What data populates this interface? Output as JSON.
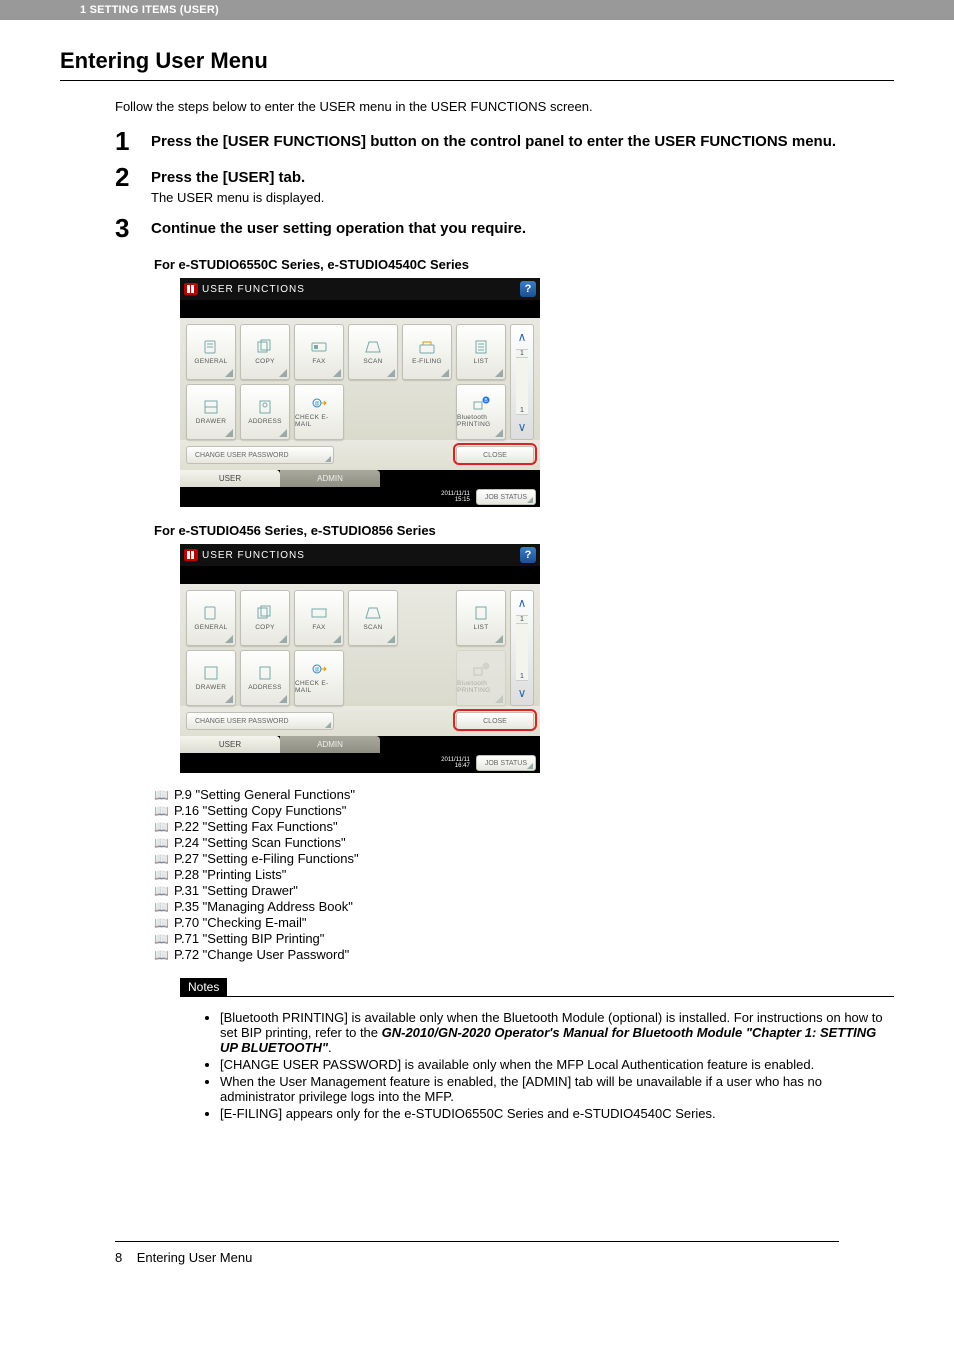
{
  "header": {
    "bar_text": "1 SETTING ITEMS (USER)"
  },
  "title": "Entering User Menu",
  "intro": "Follow the steps below to enter the USER menu in the USER FUNCTIONS screen.",
  "steps": [
    {
      "num": "1",
      "title": "Press the [USER FUNCTIONS] button on the control panel to enter the USER FUNCTIONS menu."
    },
    {
      "num": "2",
      "title": "Press the [USER] tab.",
      "sub": "The USER menu is displayed."
    },
    {
      "num": "3",
      "title": "Continue the user setting operation that you require."
    }
  ],
  "screenshots": {
    "a": {
      "label": "For e-STUDIO6550C Series, e-STUDIO4540C Series",
      "titlebar": "USER FUNCTIONS",
      "tiles_row1": [
        "GENERAL",
        "COPY",
        "FAX",
        "SCAN",
        "E-FILING",
        "LIST"
      ],
      "tiles_row2": [
        "DRAWER",
        "ADDRESS",
        "CHECK E-MAIL",
        "",
        "",
        "Bluetooth PRINTING"
      ],
      "scroll": {
        "top_page": "1",
        "bottom_page": "1"
      },
      "change_pwd": "CHANGE USER PASSWORD",
      "close": "CLOSE",
      "tab_user": "USER",
      "tab_admin": "ADMIN",
      "datetime_line1": "2011/11/11",
      "datetime_line2": "15:15",
      "jobstatus": "JOB STATUS"
    },
    "b": {
      "label": "For e-STUDIO456 Series, e-STUDIO856 Series",
      "titlebar": "USER FUNCTIONS",
      "tiles_row1": [
        "GENERAL",
        "COPY",
        "FAX",
        "SCAN",
        "",
        "LIST"
      ],
      "tiles_row2": [
        "DRAWER",
        "ADDRESS",
        "CHECK E-MAIL",
        "",
        "",
        "Bluetooth PRINTING"
      ],
      "scroll": {
        "top_page": "1",
        "bottom_page": "1"
      },
      "change_pwd": "CHANGE USER PASSWORD",
      "close": "CLOSE",
      "tab_user": "USER",
      "tab_admin": "ADMIN",
      "datetime_line1": "2011/11/11",
      "datetime_line2": "16:47",
      "jobstatus": "JOB STATUS"
    }
  },
  "links": [
    "P.9 \"Setting General Functions\"",
    "P.16 \"Setting Copy Functions\"",
    "P.22 \"Setting Fax Functions\"",
    "P.24 \"Setting Scan Functions\"",
    "P.27 \"Setting e-Filing Functions\"",
    "P.28 \"Printing Lists\"",
    "P.31 \"Setting Drawer\"",
    "P.35 \"Managing Address Book\"",
    "P.70 \"Checking E-mail\"",
    "P.71 \"Setting BIP Printing\"",
    "P.72 \"Change User Password\""
  ],
  "notes": {
    "label": "Notes",
    "items": {
      "n1a": "[Bluetooth PRINTING] is available only when the Bluetooth Module (optional) is installed. For instructions on how to set BIP printing, refer to the ",
      "n1b": "GN-2010/GN-2020 Operator's Manual for Bluetooth Module \"Chapter 1: SETTING UP BLUETOOTH\"",
      "n1c": ".",
      "n2": "[CHANGE USER PASSWORD] is available only when the MFP Local Authentication feature is enabled.",
      "n3": "When the User Management feature is enabled, the [ADMIN] tab will be unavailable if a user who has no administrator privilege logs into the MFP.",
      "n4": "[E-FILING] appears only for the e-STUDIO6550C Series and e-STUDIO4540C Series."
    }
  },
  "footer": {
    "page": "8",
    "title": "Entering User Menu"
  }
}
